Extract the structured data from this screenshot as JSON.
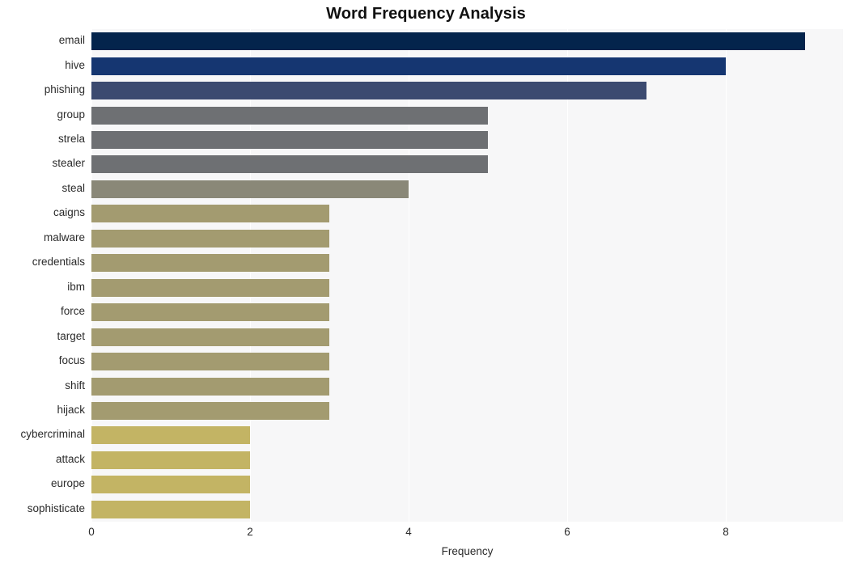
{
  "chart_data": {
    "type": "bar",
    "orientation": "horizontal",
    "title": "Word Frequency Analysis",
    "xlabel": "Frequency",
    "ylabel": "",
    "categories": [
      "email",
      "hive",
      "phishing",
      "group",
      "strela",
      "stealer",
      "steal",
      "caigns",
      "malware",
      "credentials",
      "ibm",
      "force",
      "target",
      "focus",
      "shift",
      "hijack",
      "cybercriminal",
      "attack",
      "europe",
      "sophisticate"
    ],
    "values": [
      9,
      8,
      7,
      5,
      5,
      5,
      4,
      3,
      3,
      3,
      3,
      3,
      3,
      3,
      3,
      3,
      2,
      2,
      2,
      2
    ],
    "bar_colors": [
      "#04244c",
      "#153671",
      "#3b4a70",
      "#6e7073",
      "#6e7073",
      "#6e7073",
      "#8a8878",
      "#a39b70",
      "#a39b70",
      "#a39b70",
      "#a39b70",
      "#a39b70",
      "#a39b70",
      "#a39b70",
      "#a39b70",
      "#a39b70",
      "#c3b464",
      "#c3b464",
      "#c3b464",
      "#c3b464"
    ],
    "xlim": [
      0,
      9.48
    ],
    "xticks": [
      0,
      2,
      4,
      6,
      8
    ],
    "xtick_labels": [
      "0",
      "2",
      "4",
      "6",
      "8"
    ],
    "grid": true,
    "grid_axis": "x",
    "legend": false,
    "plot_background": "#f7f7f8",
    "gridline_color": "#ffffff"
  }
}
